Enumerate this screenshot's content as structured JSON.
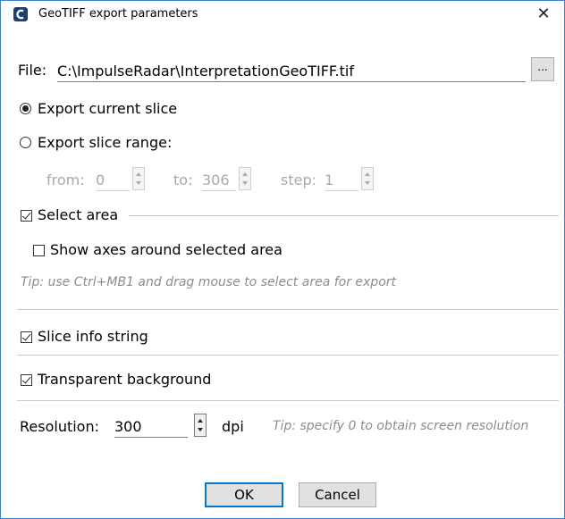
{
  "window": {
    "title": "GeoTIFF export parameters",
    "close_glyph": "✕"
  },
  "file": {
    "label": "File:",
    "value": "C:\\ImpulseRadar\\InterpretationGeoTIFF.tif",
    "browse_label": "..."
  },
  "export_mode": {
    "current_label": "Export current slice",
    "current_selected": true,
    "range_label": "Export slice range:",
    "range_selected": false
  },
  "range": {
    "from_label": "from:",
    "from_value": "0",
    "to_label": "to:",
    "to_value": "306",
    "step_label": "step:",
    "step_value": "1"
  },
  "select_area": {
    "label": "Select area",
    "checked": true,
    "show_axes_label": "Show axes around selected area",
    "show_axes_checked": false,
    "tip": "Tip: use Ctrl+MB1 and drag mouse to select area for export"
  },
  "slice_info": {
    "label": "Slice info string",
    "checked": true
  },
  "transparent_bg": {
    "label": "Transparent background",
    "checked": true
  },
  "resolution": {
    "label": "Resolution:",
    "value": "300",
    "unit": "dpi",
    "tip": "Tip: specify 0 to obtain screen resolution"
  },
  "buttons": {
    "ok": "OK",
    "cancel": "Cancel"
  },
  "colors": {
    "accent": "#0078d7",
    "window_border": "#3c7fd1"
  }
}
